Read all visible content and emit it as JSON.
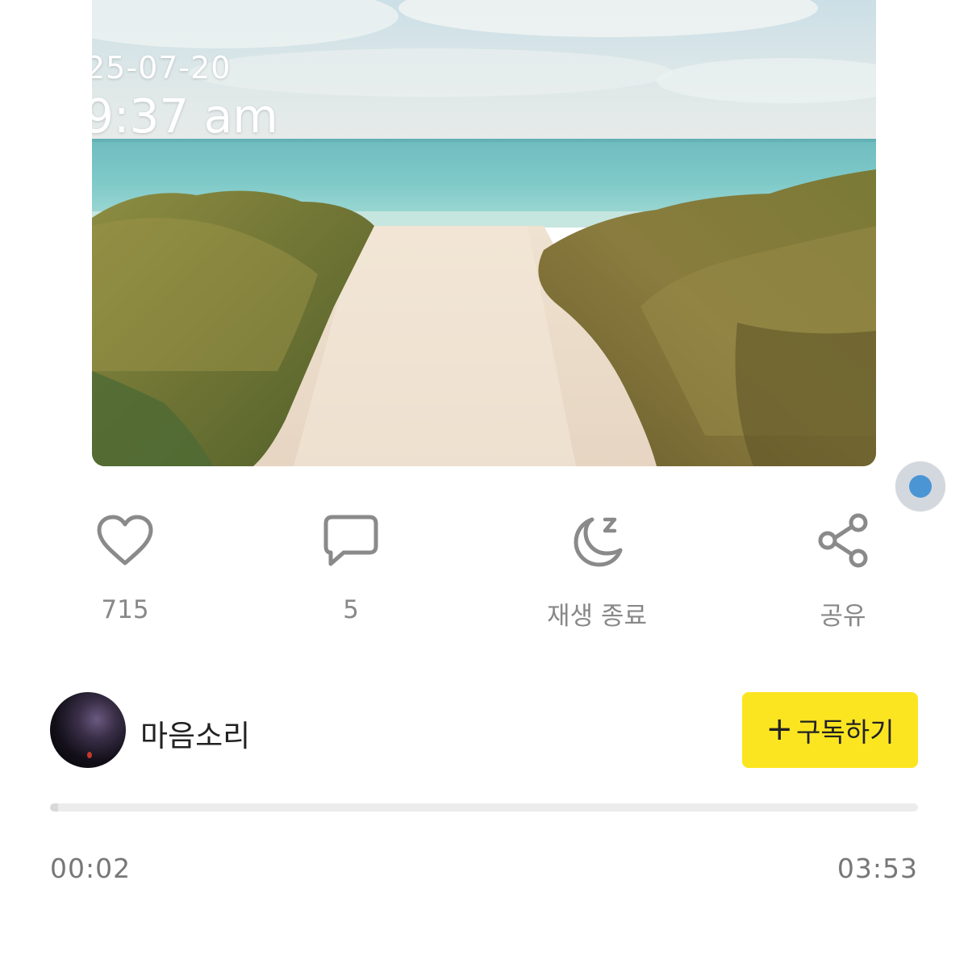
{
  "cover": {
    "date_stamp": "25-07-20",
    "time_stamp": "9:37 am"
  },
  "actions": {
    "like_count": "715",
    "comment_count": "5",
    "sleep_label": "재생 종료",
    "share_label": "공유"
  },
  "channel": {
    "name": "마음소리",
    "subscribe_label": "구독하기"
  },
  "player": {
    "elapsed": "00:02",
    "total": "03:53",
    "progress_fraction": 0.009
  },
  "icons": {
    "like": "heart-icon",
    "comment": "speech-bubble-icon",
    "sleep": "moon-sleep-icon",
    "share": "share-icon",
    "subscribe": "plus-icon"
  },
  "colors": {
    "accent": "#fbe521",
    "float_dot": "#4b95d4",
    "icon_gray": "#8a8a8a"
  }
}
